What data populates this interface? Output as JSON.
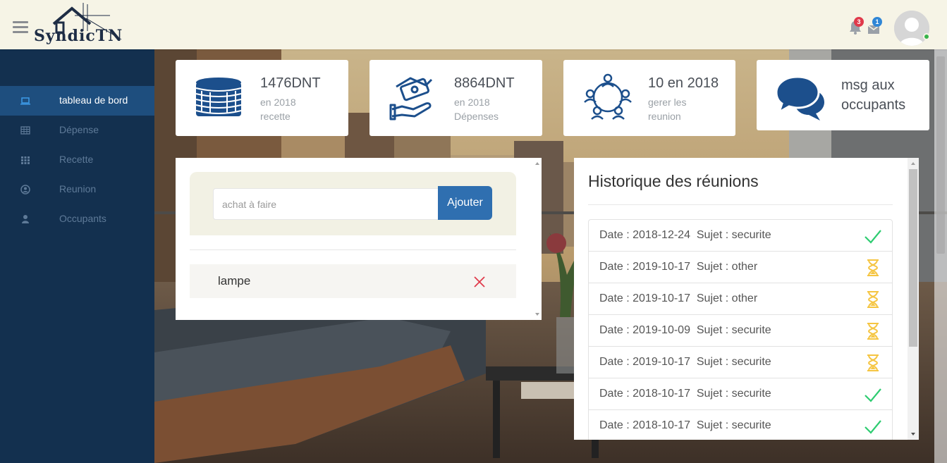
{
  "app": {
    "brand": "SyndicTN",
    "colors": {
      "header_bg": "#f6f4e6",
      "sidebar_bg": "#13304f",
      "sidebar_active": "#1e4e7e",
      "primary": "#2f6fb0",
      "success": "#2ecc71",
      "pending": "#f5c542",
      "danger": "#e03a4b"
    }
  },
  "header": {
    "menu_icon": "hamburger-icon",
    "notifications": [
      {
        "icon": "bell-icon",
        "count": "3",
        "badge_color": "#e03a4b"
      },
      {
        "icon": "envelope-icon",
        "count": "1",
        "badge_color": "#2f86d6"
      }
    ],
    "avatar_icon": "user-avatar-icon"
  },
  "sidebar": {
    "items": [
      {
        "label": "tableau de bord",
        "icon": "laptop-icon",
        "active": true
      },
      {
        "label": "Dépense",
        "icon": "table-icon",
        "active": false
      },
      {
        "label": "Recette",
        "icon": "grid-icon",
        "active": false
      },
      {
        "label": "Reunion",
        "icon": "user-circle-icon",
        "active": false
      },
      {
        "label": "Occupants",
        "icon": "user-icon",
        "active": false
      }
    ]
  },
  "cards": [
    {
      "value": "1476DNT",
      "line1": "en 2018",
      "line2": "recette",
      "icon": "coins-icon"
    },
    {
      "value": "8864DNT",
      "line1": "en 2018",
      "line2": "Dépenses",
      "icon": "money-hand-icon"
    },
    {
      "value": "10 en 2018",
      "line1": "gerer les",
      "line2": "reunion",
      "icon": "meeting-icon"
    },
    {
      "value": "msg aux",
      "line1": "occupants",
      "line2": "",
      "icon": "chat-icon"
    }
  ],
  "todo": {
    "input_placeholder": "achat à faire",
    "input_value": "",
    "add_label": "Ajouter",
    "items": [
      {
        "label": "lampe"
      }
    ]
  },
  "history": {
    "title": "Historique des réunions",
    "rows": [
      {
        "text": "Date : 2018-12-24  Sujet : securite",
        "status": "done"
      },
      {
        "text": "Date : 2019-10-17  Sujet : other",
        "status": "pending"
      },
      {
        "text": "Date : 2019-10-17  Sujet : other",
        "status": "pending"
      },
      {
        "text": "Date : 2019-10-09  Sujet : securite",
        "status": "pending"
      },
      {
        "text": "Date : 2019-10-17  Sujet : securite",
        "status": "pending"
      },
      {
        "text": "Date : 2018-10-17  Sujet : securite",
        "status": "done"
      },
      {
        "text": "Date : 2018-10-17  Sujet : securite",
        "status": "done"
      }
    ]
  }
}
